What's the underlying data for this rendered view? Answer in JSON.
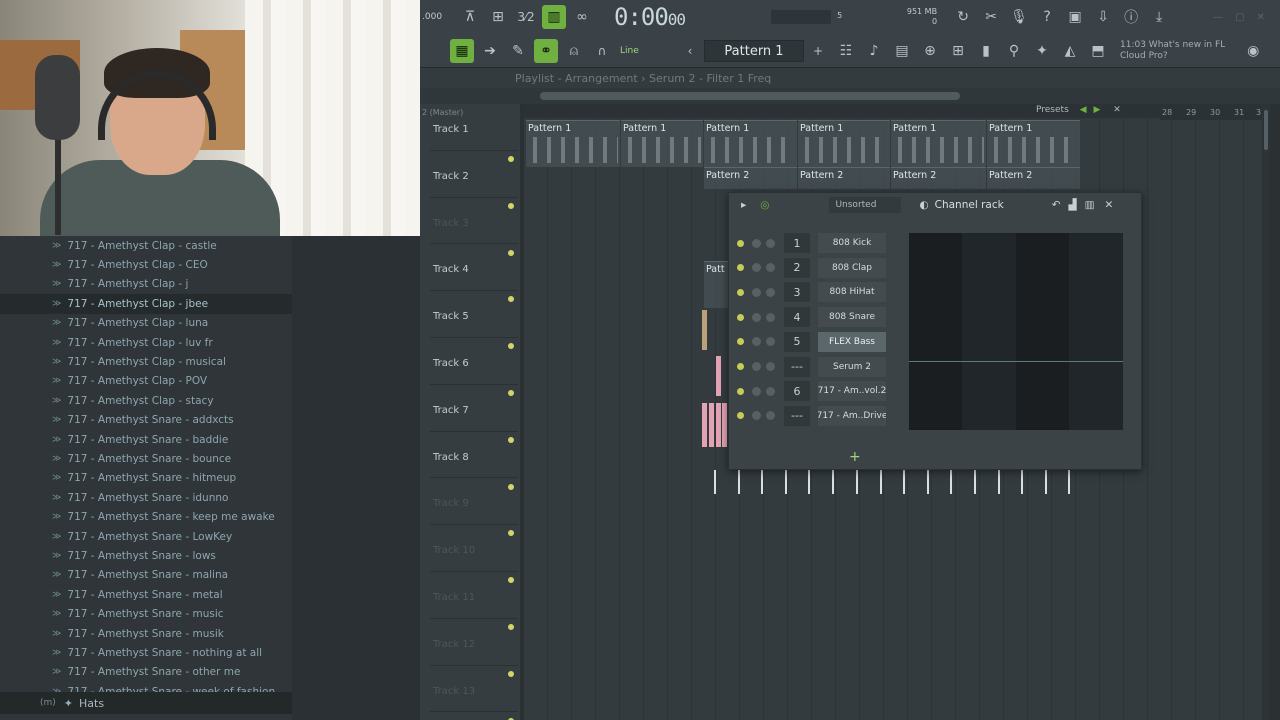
{
  "toolbar": {
    "tempo_partial": ".000",
    "time": "0:00",
    "time_sub": "00",
    "pattern": "Pattern 1",
    "snap": "Line",
    "memory": "951 MB",
    "memory_sub": "0",
    "cpu": "5",
    "news_line1": "11:03  What's new in FL",
    "news_line2": "Cloud Pro?"
  },
  "playlist": {
    "title": "Playlist - Arrangement › Serum 2 - Filter 1 Freq",
    "master_label": "2 (Master)",
    "presets_label": "Presets",
    "bar_numbers": [
      "28",
      "29",
      "30",
      "31",
      "3"
    ],
    "tracks": [
      {
        "name": "Track 1",
        "dim": false
      },
      {
        "name": "Track 2",
        "dim": false
      },
      {
        "name": "Track 3",
        "dim": true
      },
      {
        "name": "Track 4",
        "dim": false
      },
      {
        "name": "Track 5",
        "dim": false
      },
      {
        "name": "Track 6",
        "dim": false
      },
      {
        "name": "Track 7",
        "dim": false
      },
      {
        "name": "Track 8",
        "dim": false
      },
      {
        "name": "Track 9",
        "dim": true
      },
      {
        "name": "Track 10",
        "dim": true
      },
      {
        "name": "Track 11",
        "dim": true
      },
      {
        "name": "Track 12",
        "dim": true
      },
      {
        "name": "Track 13",
        "dim": true
      }
    ],
    "pattern1_label": "Pattern 1",
    "pattern2_label": "Pattern 2",
    "pattern_partial": "Patt"
  },
  "browser": {
    "items": [
      "717 - Amethyst Clap - castle",
      "717 - Amethyst Clap - CEO",
      "717 - Amethyst Clap - j",
      "717 - Amethyst Clap - jbee",
      "717 - Amethyst Clap - luna",
      "717 - Amethyst Clap - luv fr",
      "717 - Amethyst Clap - musical",
      "717 - Amethyst Clap - POV",
      "717 - Amethyst Clap - stacy",
      "717 - Amethyst Snare - addxcts",
      "717 - Amethyst Snare - baddie",
      "717 - Amethyst Snare - bounce",
      "717 - Amethyst Snare - hitmeup",
      "717 - Amethyst Snare - idunno",
      "717 - Amethyst Snare - keep me awake",
      "717 - Amethyst Snare - LowKey",
      "717 - Amethyst Snare - lows",
      "717 - Amethyst Snare - malina",
      "717 - Amethyst Snare - metal",
      "717 - Amethyst Snare - music",
      "717 - Amethyst Snare - musik",
      "717 - Amethyst Snare - nothing at all",
      "717 - Amethyst Snare - other me",
      "717 - Amethyst Snare - week of fashion"
    ],
    "selected_index": 3,
    "folder_label": "Hats",
    "folder_prefix": "(m)"
  },
  "channel_rack": {
    "sort": "Unsorted",
    "title": "Channel rack",
    "channels": [
      {
        "num": "1",
        "name": "808 Kick",
        "active": false
      },
      {
        "num": "2",
        "name": "808 Clap",
        "active": false
      },
      {
        "num": "3",
        "name": "808 HiHat",
        "active": false
      },
      {
        "num": "4",
        "name": "808 Snare",
        "active": false
      },
      {
        "num": "5",
        "name": "FLEX Bass",
        "active": true
      },
      {
        "num": "---",
        "name": "Serum 2",
        "active": false
      },
      {
        "num": "6",
        "name": "717 - Am..vol.2",
        "active": false
      },
      {
        "num": "---",
        "name": "717 - Am..Drive",
        "active": false
      }
    ]
  },
  "colors": {
    "accent_green": "#6fb040",
    "track_led": "#d5d36a",
    "pink_clip": "#e3a3b4"
  }
}
